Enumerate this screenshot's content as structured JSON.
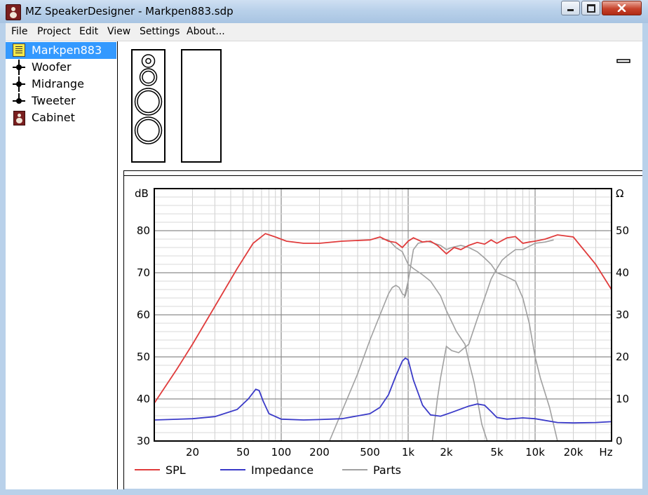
{
  "window": {
    "title": "MZ SpeakerDesigner - Markpen883.sdp"
  },
  "menu": [
    "File",
    "Project",
    "Edit",
    "View",
    "Settings",
    "About..."
  ],
  "tree": {
    "items": [
      {
        "label": "Markpen883",
        "icon": "document-icon",
        "selected": true
      },
      {
        "label": "Woofer",
        "icon": "driver-node-icon",
        "selected": false
      },
      {
        "label": "Midrange",
        "icon": "driver-node-icon",
        "selected": false
      },
      {
        "label": "Tweeter",
        "icon": "driver-node-icon",
        "selected": false
      },
      {
        "label": "Cabinet",
        "icon": "cabinet-icon",
        "selected": false
      }
    ]
  },
  "chart_data": {
    "type": "line",
    "x_scale": "log",
    "xlim": [
      10,
      40000
    ],
    "ylabel": "dB",
    "y2label": "Ω",
    "ylim": [
      30,
      90
    ],
    "y2lim": [
      0,
      60
    ],
    "x_tick_labels": [
      {
        "value": 20,
        "label": "20"
      },
      {
        "value": 50,
        "label": "50"
      },
      {
        "value": 100,
        "label": "100"
      },
      {
        "value": 200,
        "label": "200"
      },
      {
        "value": 500,
        "label": "500"
      },
      {
        "value": 1000,
        "label": "1k"
      },
      {
        "value": 2000,
        "label": "2k"
      },
      {
        "value": 5000,
        "label": "5k"
      },
      {
        "value": 10000,
        "label": "10k"
      },
      {
        "value": 20000,
        "label": "20k"
      }
    ],
    "x_unit": "Hz",
    "y_ticks": [
      30,
      40,
      50,
      60,
      70,
      80
    ],
    "y2_ticks": [
      0,
      10,
      20,
      30,
      40,
      50
    ],
    "grid": true,
    "legend_position": "bottom",
    "series": [
      {
        "name": "SPL",
        "color": "#e03c3c",
        "axis": "left",
        "x": [
          10,
          15,
          20,
          30,
          45,
          60,
          75,
          90,
          110,
          150,
          200,
          300,
          500,
          600,
          700,
          800,
          900,
          1000,
          1100,
          1300,
          1500,
          1700,
          2000,
          2300,
          2600,
          3000,
          3500,
          4000,
          4500,
          5000,
          6000,
          7000,
          8000,
          9000,
          10000,
          12000,
          15000,
          20000,
          30000,
          40000
        ],
        "y": [
          39,
          47,
          53,
          62,
          71,
          77,
          79.3,
          78.5,
          77.5,
          77,
          77,
          77.5,
          77.8,
          78.5,
          77.5,
          77.2,
          76,
          77.5,
          78.3,
          77.3,
          77.5,
          76.5,
          74.5,
          76,
          75.5,
          76.5,
          77.2,
          76.8,
          77.8,
          77,
          78.3,
          78.6,
          77,
          77.3,
          77.5,
          78,
          79,
          78.5,
          72,
          66
        ]
      },
      {
        "name": "Impedance",
        "color": "#3a3ac8",
        "axis": "right",
        "x": [
          10,
          20,
          30,
          45,
          55,
          63,
          67,
          72,
          80,
          100,
          150,
          200,
          300,
          500,
          600,
          700,
          800,
          900,
          950,
          1000,
          1100,
          1300,
          1500,
          1800,
          2200,
          3000,
          3500,
          4000,
          4500,
          5000,
          6000,
          8000,
          10000,
          15000,
          20000,
          30000,
          40000
        ],
        "y": [
          5,
          5.3,
          5.8,
          7.5,
          10,
          12.3,
          12,
          9.5,
          6.5,
          5.2,
          5,
          5.1,
          5.3,
          6.5,
          8,
          11,
          15.5,
          19,
          19.7,
          19.3,
          14.5,
          8.5,
          6.2,
          5.9,
          6.8,
          8.3,
          8.8,
          8.5,
          7,
          5.6,
          5.2,
          5.5,
          5.3,
          4.4,
          4.3,
          4.4,
          4.6
        ]
      },
      {
        "name": "Parts",
        "color": "#a0a0a0",
        "axis": "left",
        "x": [
          10
        ],
        "y": [
          30
        ]
      }
    ],
    "parts_curves": [
      {
        "x": [
          240,
          300,
          400,
          500,
          600,
          700,
          750,
          800,
          850,
          900,
          950,
          1000
        ],
        "y": [
          30,
          37,
          46,
          54,
          60,
          65,
          66.5,
          67,
          66.5,
          65,
          64.5,
          67
        ]
      },
      {
        "x": [
          620,
          700,
          800,
          900,
          1000,
          1100,
          1300,
          1500,
          1800,
          2000,
          2400,
          2800,
          3000,
          3300,
          3600,
          3800,
          4200
        ],
        "y": [
          78,
          77.8,
          76,
          75,
          72,
          71,
          69.5,
          68,
          64.5,
          61,
          56,
          53,
          49,
          44,
          38,
          34,
          30
        ]
      },
      {
        "x": [
          930,
          1000,
          1100,
          1200,
          1400,
          1600,
          1800,
          2000,
          2200,
          2600,
          3000,
          3500,
          4000,
          4500,
          5000,
          5500,
          6000,
          7000,
          8000,
          9000,
          10000,
          11000,
          13000,
          15000
        ],
        "y": [
          64,
          68,
          75.5,
          77,
          77.5,
          77,
          76.5,
          75.5,
          76,
          76.5,
          76,
          75,
          73.5,
          72,
          70,
          69.5,
          69,
          68,
          64,
          58,
          50,
          45,
          38,
          30
        ]
      },
      {
        "x": [
          1550,
          1700,
          1800,
          2000,
          2200,
          2500,
          3000,
          3500,
          4000,
          4500,
          5000,
          5500,
          6000,
          7000,
          8000,
          10000,
          12000,
          14000
        ],
        "y": [
          30,
          40,
          45,
          52.5,
          51.5,
          51,
          53,
          59,
          64,
          68.5,
          71,
          73,
          74,
          75.5,
          75.5,
          77,
          77.3,
          77.8
        ]
      }
    ],
    "legend": [
      {
        "name": "SPL",
        "color": "#e03c3c"
      },
      {
        "name": "Impedance",
        "color": "#3a3ac8"
      },
      {
        "name": "Parts",
        "color": "#a0a0a0"
      }
    ]
  }
}
